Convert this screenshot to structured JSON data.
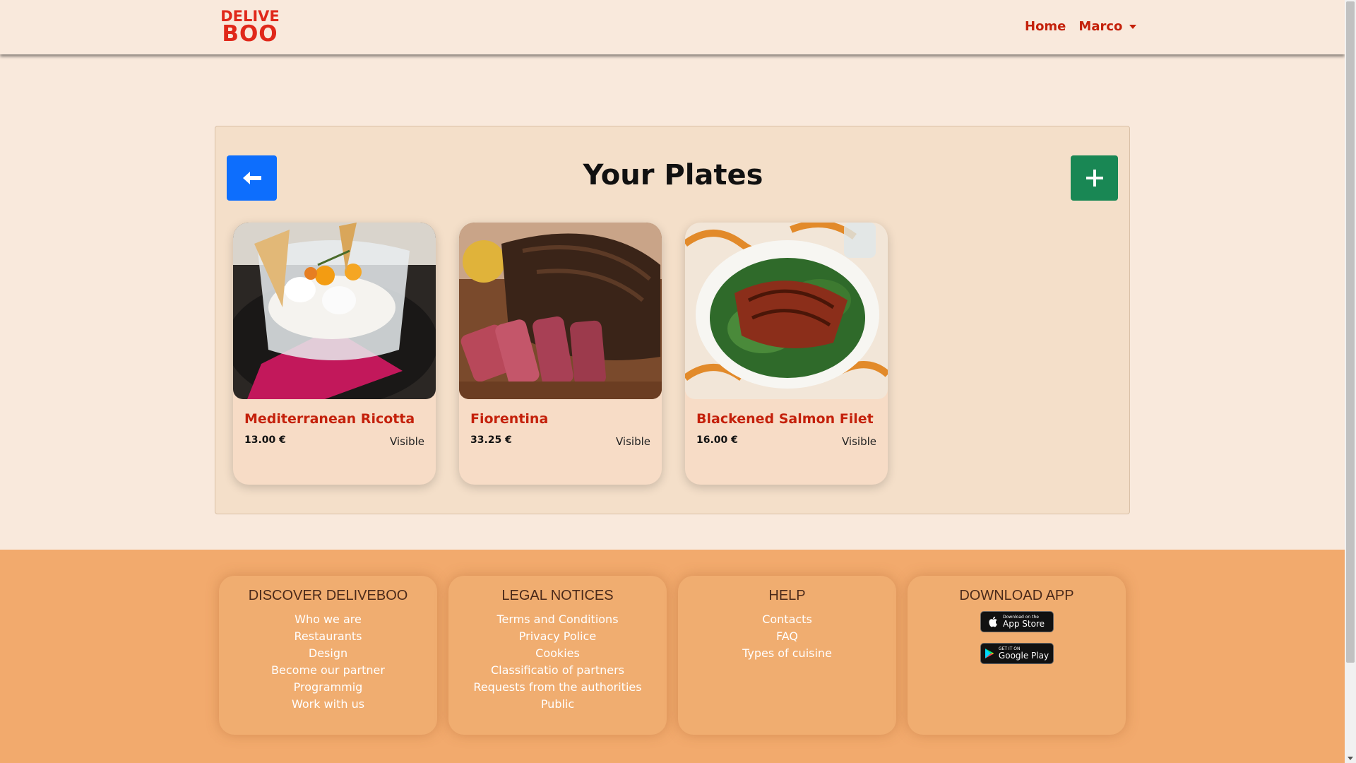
{
  "navbar": {
    "logo": {
      "line1": "DELIVE",
      "line2": "BOO"
    },
    "home_label": "Home",
    "user_label": "Marco"
  },
  "panel": {
    "title": "Your Plates"
  },
  "plates": [
    {
      "name": "Mediterranean Ricotta",
      "price": "13.00 €",
      "visibility": "Visible"
    },
    {
      "name": "Fiorentina",
      "price": "33.25 €",
      "visibility": "Visible"
    },
    {
      "name": "Blackened Salmon Filet",
      "price": "16.00 €",
      "visibility": "Visible"
    }
  ],
  "footer": {
    "columns": [
      {
        "title": "DISCOVER DELIVEBOO",
        "links": [
          "Who we are",
          "Restaurants",
          "Design",
          "Become our partner",
          "Programmig",
          "Work with us"
        ]
      },
      {
        "title": "LEGAL NOTICES",
        "links": [
          "Terms and Conditions",
          "Privacy Police",
          "Cookies",
          "Classificatio of partners",
          "Requests from the authorities",
          "Public"
        ]
      },
      {
        "title": "HELP",
        "links": [
          "Contacts",
          "FAQ",
          "Types of cuisine"
        ]
      },
      {
        "title": "DOWNLOAD APP",
        "links": []
      }
    ],
    "app_store": {
      "small": "Download on the",
      "big": "App Store"
    },
    "google_play": {
      "small": "GET IT ON",
      "big": "Google Play"
    }
  },
  "colors": {
    "brand_red": "#c4210b",
    "primary_blue": "#0d6efd",
    "success_green": "#198754",
    "footer_orange": "#f2aa6d",
    "page_bg": "#f9e9dc"
  },
  "icons": {
    "back": "arrow-left-icon",
    "add": "plus-icon",
    "dropdown": "caret-down-icon"
  }
}
